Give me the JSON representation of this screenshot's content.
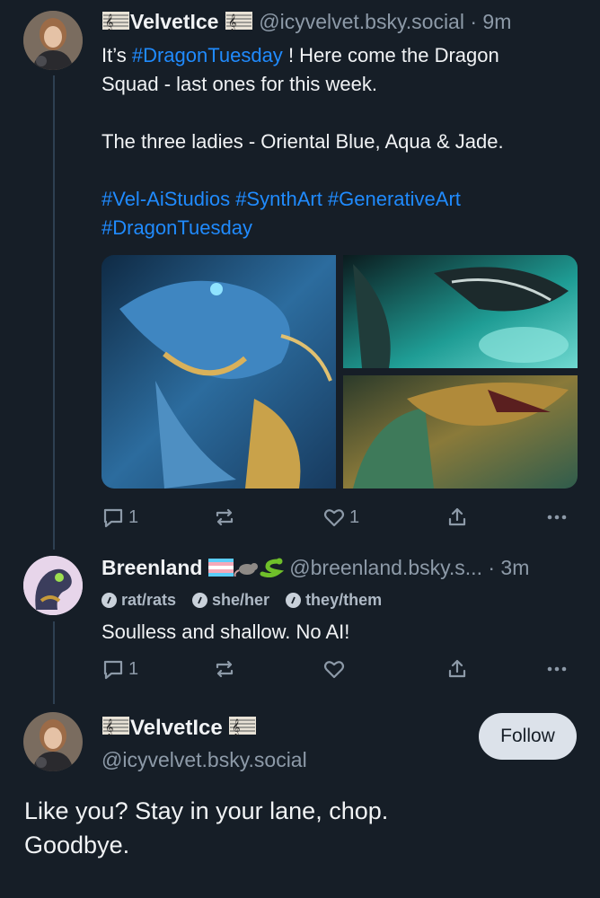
{
  "post1": {
    "display_name": "VelvetIce",
    "handle": "@icyvelvet.bsky.social",
    "separator": "·",
    "time": "9m",
    "text_line1_a": "It’s",
    "text_line1_tag": "#DragonTuesday",
    "text_line1_b": "!  Here come the Dragon",
    "text_line2": "Squad - last ones for this week.",
    "text_line3": "The three ladies - Oriental Blue, Aqua & Jade.",
    "tags_line1": "#Vel-AiStudios #SynthArt #GenerativeArt",
    "tags_line2": "#DragonTuesday",
    "replies": "1",
    "likes": "1"
  },
  "reply": {
    "display_name": "Breenland",
    "handle": "@breenland.bsky.s...",
    "separator": "·",
    "time": "3m",
    "badges": [
      "rat/rats",
      "she/her",
      "they/them"
    ],
    "text": "Soulless and shallow. No AI!",
    "replies": "1"
  },
  "main_post": {
    "display_name": "VelvetIce",
    "handle": "@icyvelvet.bsky.social",
    "follow_label": "Follow",
    "text_line1": "Like you? Stay in your lane, chop.",
    "text_line2": "Goodbye."
  },
  "colors": {
    "background": "#161e27",
    "link": "#208bfe",
    "muted": "#8d9aa8",
    "thread_line": "#2e4052"
  },
  "icons": [
    "reply-icon",
    "repost-icon",
    "like-icon",
    "share-icon",
    "more-icon",
    "music-score-icon",
    "pride-flag-icon",
    "rat-icon",
    "snake-icon"
  ]
}
